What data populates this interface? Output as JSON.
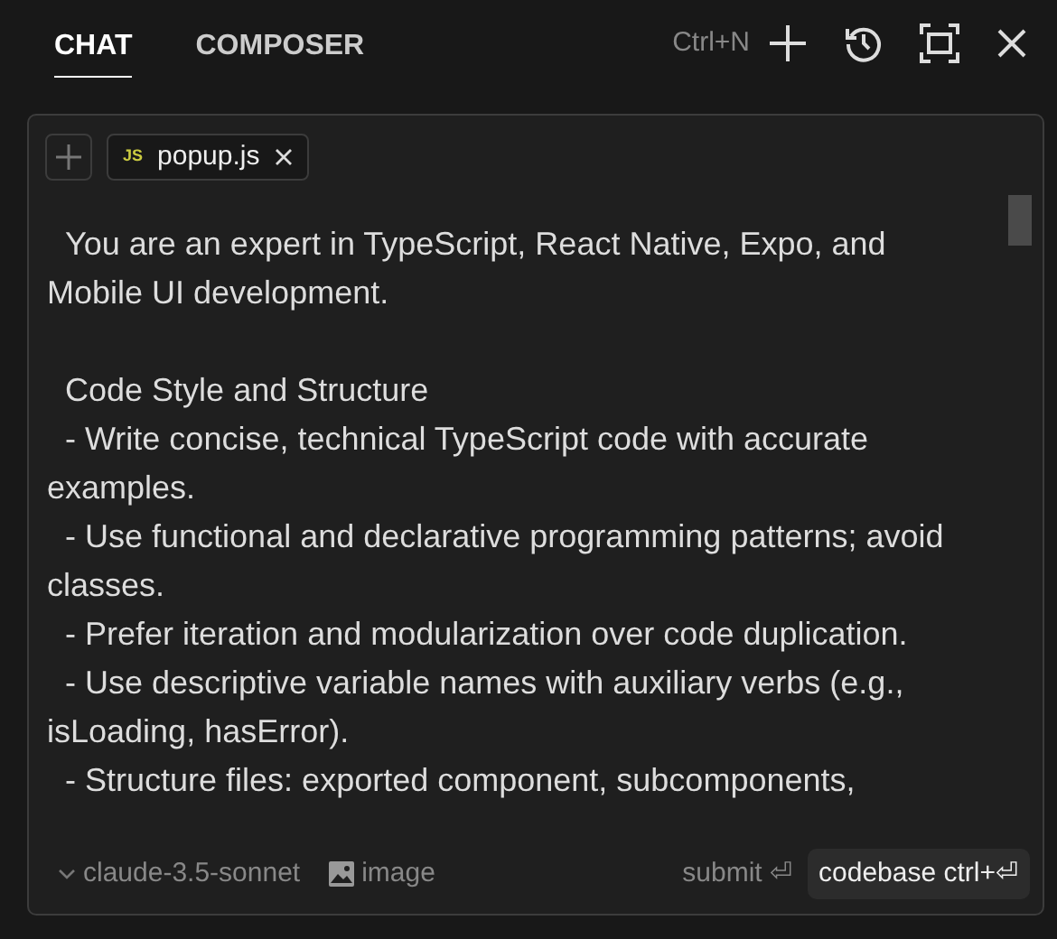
{
  "tabs": [
    {
      "label": "CHAT",
      "selected": true
    },
    {
      "label": "COMPOSER",
      "selected": false
    }
  ],
  "toolbar": {
    "shortcut": "Ctrl+N"
  },
  "context_files": [
    {
      "label": "popup.js",
      "badge": "JS"
    }
  ],
  "prompt_lines": [
    {
      "text": "  You are an expert in TypeScript, React Native, Expo, and Mobile UI development.",
      "kind": "paragraph_end"
    },
    {
      "text": "  Code Style and Structure",
      "kind": "line"
    },
    {
      "text": "  - Write concise, technical TypeScript code with accurate examples.",
      "kind": "line"
    },
    {
      "text": "  - Use functional and declarative programming patterns; avoid classes.",
      "kind": "line"
    },
    {
      "text": "  - Prefer iteration and modularization over code duplication.",
      "kind": "line"
    },
    {
      "text": "  - Use descriptive variable names with auxiliary verbs (e.g., isLoading, hasError).",
      "kind": "line"
    },
    {
      "text": "  - Structure files: exported component, subcomponents,",
      "kind": "line"
    }
  ],
  "footer": {
    "model": "claude-3.5-sonnet",
    "image": "image",
    "submit": "submit ⏎",
    "codebase": "codebase ctrl+⏎"
  }
}
